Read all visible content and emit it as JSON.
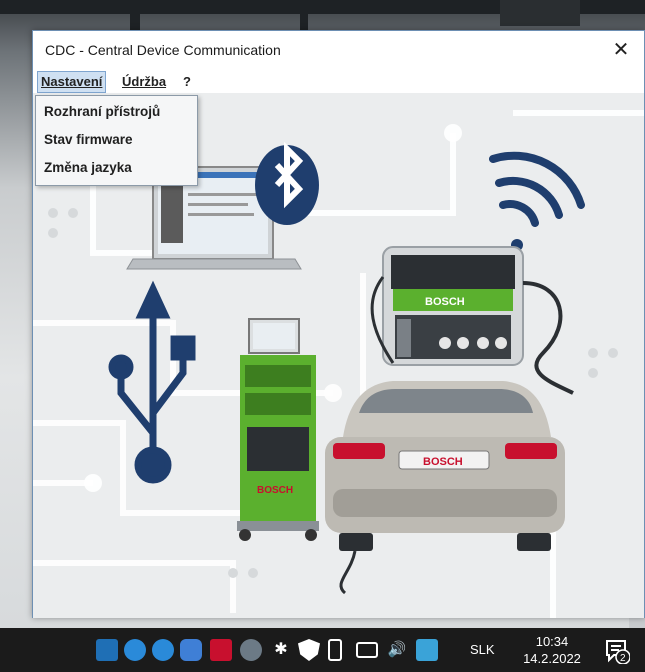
{
  "window": {
    "title": "CDC - Central Device Communication",
    "close_glyph": "✕"
  },
  "menu": {
    "items": [
      {
        "label": "Nastavení",
        "mnemonic": "N"
      },
      {
        "label": "Údržba",
        "mnemonic": "Ú"
      },
      {
        "label": "?"
      }
    ],
    "dropdown": [
      {
        "label": "Rozhraní přístrojů"
      },
      {
        "label": "Stav firmware"
      },
      {
        "label": "Změna jazyka"
      }
    ]
  },
  "illustration": {
    "brand_label_device": "BOSCH",
    "brand_label_cart": "BOSCH",
    "brand_label_plate": "BOSCH",
    "icons": [
      "bluetooth-icon",
      "wifi-icon",
      "usb-icon"
    ],
    "colors": {
      "bluetooth": "#1f3e6e",
      "bosch_green": "#5bb02e",
      "usb": "#1f3e6e"
    }
  },
  "taskbar": {
    "language": "SLK",
    "time": "10:34",
    "date": "14.2.2022",
    "notification_count": "2",
    "tray_icons": [
      "teamviewer-icon",
      "remote-icon",
      "network-globe-icon",
      "sync-icon",
      "pdf-icon",
      "snipping-icon",
      "bluetooth-tray-icon",
      "shield-icon",
      "usb-tray-icon",
      "monitor-network-icon",
      "volume-icon",
      "app-icon"
    ]
  }
}
